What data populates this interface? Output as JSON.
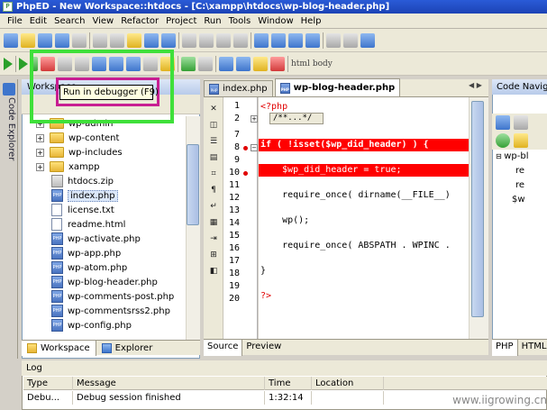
{
  "window": {
    "title": "PhpED - New Workspace::htdocs - [C:\\xampp\\htdocs\\wp-blog-header.php]"
  },
  "menu": [
    "File",
    "Edit",
    "Search",
    "View",
    "Refactor",
    "Project",
    "Run",
    "Tools",
    "Window",
    "Help"
  ],
  "tooltip": "Run in debugger (F9)",
  "left_rail": {
    "label": "Code Explorer"
  },
  "workspace": {
    "title": "Workspace",
    "items": [
      {
        "label": "wp-admin",
        "kind": "folder",
        "expandable": true
      },
      {
        "label": "wp-content",
        "kind": "folder",
        "expandable": true
      },
      {
        "label": "wp-includes",
        "kind": "folder",
        "expandable": true
      },
      {
        "label": "xampp",
        "kind": "folder",
        "expandable": true
      },
      {
        "label": "htdocs.zip",
        "kind": "zip",
        "expandable": false
      },
      {
        "label": "index.php",
        "kind": "php",
        "expandable": false,
        "selected": true
      },
      {
        "label": "license.txt",
        "kind": "file",
        "expandable": false
      },
      {
        "label": "readme.html",
        "kind": "file",
        "expandable": false
      },
      {
        "label": "wp-activate.php",
        "kind": "php",
        "expandable": false
      },
      {
        "label": "wp-app.php",
        "kind": "php",
        "expandable": false
      },
      {
        "label": "wp-atom.php",
        "kind": "php",
        "expandable": false
      },
      {
        "label": "wp-blog-header.php",
        "kind": "php",
        "expandable": false
      },
      {
        "label": "wp-comments-post.php",
        "kind": "php",
        "expandable": false
      },
      {
        "label": "wp-commentsrss2.php",
        "kind": "php",
        "expandable": false
      },
      {
        "label": "wp-config.php",
        "kind": "php",
        "expandable": false
      }
    ],
    "tabs": [
      "Workspace",
      "Explorer"
    ]
  },
  "editor": {
    "tabs": [
      {
        "label": "index.php",
        "active": false
      },
      {
        "label": "wp-blog-header.php",
        "active": true
      }
    ],
    "folded_comment": "/**...*/",
    "lines": [
      {
        "num": "1",
        "text": "<?php",
        "style": "php"
      },
      {
        "num": "2",
        "text": "",
        "style": ""
      },
      {
        "num": "7",
        "text": "",
        "style": ""
      },
      {
        "num": "8",
        "text": "if ( !isset($wp_did_header) ) {",
        "style": "hl",
        "breakpoint": true
      },
      {
        "num": "9",
        "text": "",
        "style": ""
      },
      {
        "num": "10",
        "text": "    $wp_did_header = true;",
        "style": "hl",
        "breakpoint": true
      },
      {
        "num": "11",
        "text": "",
        "style": ""
      },
      {
        "num": "12",
        "text": "    require_once( dirname(__FILE__)",
        "style": ""
      },
      {
        "num": "13",
        "text": "",
        "style": ""
      },
      {
        "num": "14",
        "text": "    wp();",
        "style": ""
      },
      {
        "num": "15",
        "text": "",
        "style": ""
      },
      {
        "num": "16",
        "text": "    require_once( ABSPATH . WPINC .",
        "style": ""
      },
      {
        "num": "17",
        "text": "",
        "style": ""
      },
      {
        "num": "18",
        "text": "}",
        "style": ""
      },
      {
        "num": "19",
        "text": "",
        "style": ""
      },
      {
        "num": "20",
        "text": "?>",
        "style": "php"
      }
    ],
    "bottom_tabs": [
      "Source",
      "Preview"
    ]
  },
  "navigator": {
    "title": "Code Navigator",
    "tree": [
      "wp-bl",
      "re",
      "re",
      "$w"
    ],
    "bottom_tabs": [
      "PHP",
      "HTML"
    ]
  },
  "toolbar": {
    "html_label": "html",
    "body_label": "body"
  },
  "log": {
    "title": "Log",
    "columns": [
      "Type",
      "Message",
      "Time",
      "Location"
    ],
    "rows": [
      {
        "type": "Debu...",
        "message": "Debug session finished",
        "time": "1:32:14",
        "location": ""
      }
    ]
  },
  "watermark": "www.iigrowing.cn"
}
